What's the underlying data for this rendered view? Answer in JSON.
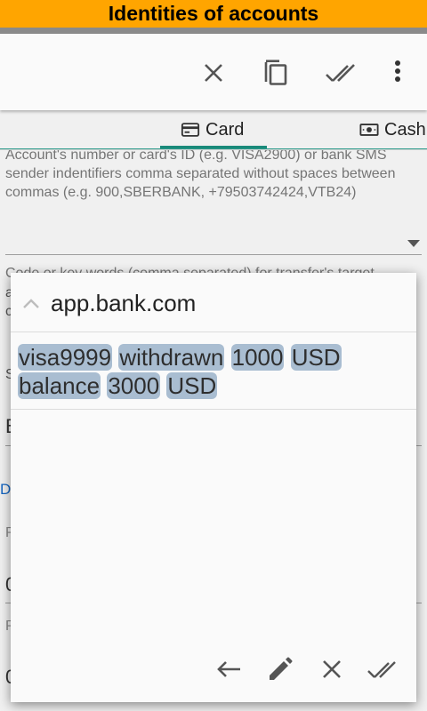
{
  "window": {
    "title": "Identities of accounts"
  },
  "toolbar": {
    "actions": [
      {
        "icon": "close-icon"
      },
      {
        "icon": "copy-icon"
      },
      {
        "icon": "done-all-icon"
      },
      {
        "icon": "more-vert-icon"
      }
    ]
  },
  "tabs": [
    {
      "label": "Card",
      "icon": "credit-card-icon",
      "selected": true
    },
    {
      "label": "Cash",
      "icon": "cash-icon",
      "selected": false
    }
  ],
  "form": {
    "account_help": "Account's number or card's ID (e.g. VISA2900) or bank SMS sender indentifiers comma separated without spaces between commas (e.g. 900,SBERBANK, +79503742424,VTB24)",
    "codes_help": "Code or key words (comma separated) for transfer's target",
    "fragments": {
      "letter_a": "a",
      "letter_c": "c",
      "letter_s": "S",
      "letter_b": "B",
      "letter_d": "D",
      "letter_p": "P",
      "letter_o": "0",
      "letter_p2": "P",
      "letter_o2": "0"
    }
  },
  "popup": {
    "title": "app.bank.com",
    "tokens_line1": [
      "visa9999",
      "withdrawn",
      "1000",
      "USD"
    ],
    "tokens_line2": [
      "balance",
      "3000",
      "USD"
    ],
    "actions": [
      {
        "icon": "arrow-back-icon"
      },
      {
        "icon": "edit-icon"
      },
      {
        "icon": "close-icon"
      },
      {
        "icon": "done-all-icon"
      }
    ]
  },
  "colors": {
    "title_bar": "#ffa500",
    "accent": "#1a8a7a",
    "token_highlight": "#a9bdd1"
  }
}
